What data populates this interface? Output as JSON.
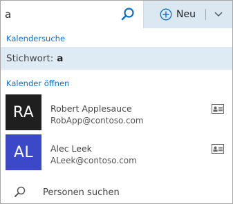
{
  "search": {
    "value": "a",
    "placeholder": ""
  },
  "toolbar": {
    "new_label": "Neu"
  },
  "sections": {
    "calendar_search": "Kalendersuche",
    "open_calendar": "Kalender öffnen"
  },
  "keyword": {
    "label": "Stichwort:",
    "value": "a"
  },
  "people": [
    {
      "initials": "RA",
      "name": "Robert Applesauce",
      "email": "RobApp@contoso.com",
      "avatar_color": "#1f1f1f"
    },
    {
      "initials": "AL",
      "name": "Alec Leek",
      "email": "ALeek@contoso.com",
      "avatar_color": "#3b49c9"
    }
  ],
  "footer": {
    "label": "Personen suchen"
  },
  "colors": {
    "accent": "#0f6fc6",
    "topbar": "#dbe7f1",
    "highlight": "#deeaf4"
  },
  "icons": [
    "search-icon",
    "plus-circle-icon",
    "chevron-down-icon",
    "contact-card-icon"
  ]
}
